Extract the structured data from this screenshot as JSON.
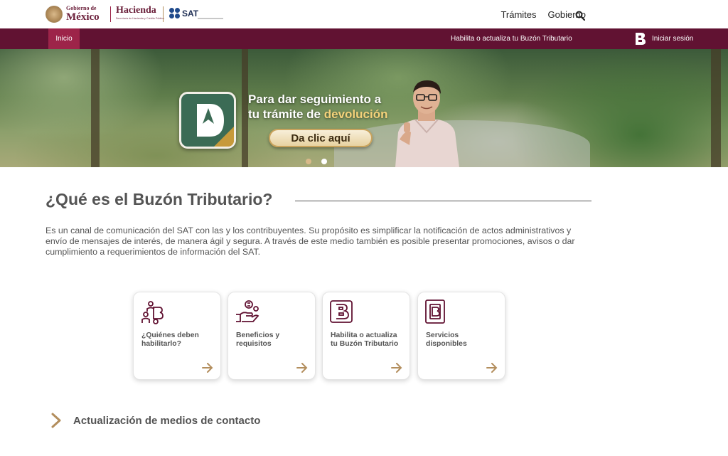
{
  "header": {
    "gobierno_small": "Gobierno de",
    "gobierno_big": "México",
    "hacienda_name": "Hacienda",
    "hacienda_sub": "Secretaría de Hacienda y Crédito Público",
    "sat_label": "SAT",
    "nav": [
      {
        "label": "Trámites"
      },
      {
        "label": "Gobierno"
      }
    ],
    "search_icon": "search-icon"
  },
  "mainnav": {
    "inicio": "Inicio",
    "buzon_link": "Habilita o actualiza tu Buzón Tributario",
    "login": "Iniciar sesión"
  },
  "hero": {
    "line1": "Para dar seguimiento a",
    "line2_prefix": "tu trámite de ",
    "line2_accent": "devolución",
    "cta": "Da clic aquí",
    "slides": 2,
    "active_slide": 2
  },
  "section": {
    "title": "¿Qué es el Buzón Tributario?",
    "description": "Es un canal de comunicación del SAT con las y los contribuyentes. Su propósito es simplificar la notificación de actos administrativos y envío de mensajes de interés, de manera ágil y segura. A través de este medio también es posible presentar promociones, avisos o dar cumplimiento a requerimientos de información del SAT."
  },
  "cards": [
    {
      "label": "¿Quiénes deben habilitarlo?",
      "icon": "people-b-icon"
    },
    {
      "label": "Beneficios y requisitos",
      "icon": "benefits-icon"
    },
    {
      "label": "Habilita o actualiza tu Buzón Tributario",
      "icon": "buzon-b-icon"
    },
    {
      "label": "Servicios disponibles",
      "icon": "services-icon"
    }
  ],
  "accordion": {
    "label": "Actualización de medios de contacto"
  },
  "colors": {
    "burgundy": "#611232",
    "burgundy_active": "#9d2449",
    "gold": "#b38e5d",
    "text": "#545454"
  }
}
